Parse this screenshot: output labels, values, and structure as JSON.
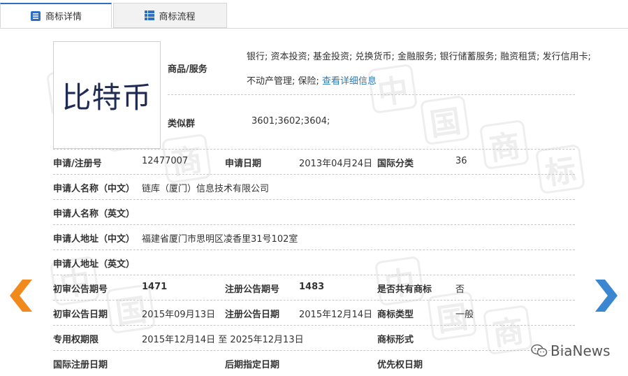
{
  "tabs": [
    {
      "label": "商标详情",
      "icon": "list-icon",
      "active": true
    },
    {
      "label": "商标流程",
      "icon": "grid-icon",
      "active": false
    }
  ],
  "logo_text": "比特币",
  "watermark_chars": [
    "中",
    "国",
    "商",
    "标"
  ],
  "goods": {
    "label": "商品/服务",
    "line1": "银行; 资本投资; 基金投资; 兑换货币; 金融服务; 银行储蓄服务; 融资租赁; 发行信用卡;",
    "line2": "不动产管理; 保险;",
    "link": "查看详细信息"
  },
  "similar": {
    "label": "类似群",
    "value": "3601;3602;3604;"
  },
  "rows": {
    "reg_no": {
      "label": "申请/注册号",
      "value": "12477007"
    },
    "apply_date": {
      "label": "申请日期",
      "value": "2013年04月24日"
    },
    "intl_class": {
      "label": "国际分类",
      "value": "36"
    },
    "applicant_cn": {
      "label": "申请人名称（中文）",
      "value": "链库（厦门）信息技术有限公司"
    },
    "applicant_en": {
      "label": "申请人名称（英文）",
      "value": ""
    },
    "address_cn": {
      "label": "申请人地址（中文）",
      "value": "福建省厦门市思明区凌香里31号102室"
    },
    "address_en": {
      "label": "申请人地址（英文）",
      "value": ""
    },
    "prelim_no": {
      "label": "初审公告期号",
      "value": "1471"
    },
    "reg_pub_no": {
      "label": "注册公告期号",
      "value": "1483"
    },
    "shared": {
      "label": "是否共有商标",
      "value": "否"
    },
    "prelim_date": {
      "label": "初审公告日期",
      "value": "2015年09月13日"
    },
    "reg_pub_date": {
      "label": "注册公告日期",
      "value": "2015年12月14日"
    },
    "mark_type": {
      "label": "商标类型",
      "value": "一般"
    },
    "term": {
      "label": "专用权期限",
      "value": "2015年12月14日 至 2025年12月13日"
    },
    "mark_form": {
      "label": "商标形式",
      "value": ""
    },
    "intl_reg_date": {
      "label": "国际注册日期",
      "value": ""
    },
    "later_date": {
      "label": "后期指定日期",
      "value": ""
    },
    "priority_date": {
      "label": "优先权日期",
      "value": ""
    }
  },
  "nav": {
    "prev": "prev-arrow",
    "next": "next-arrow"
  },
  "brand": "BiaNews",
  "colors": {
    "accent": "#2e6fc1",
    "arrow_prev": "#f08a1c",
    "arrow_next": "#3a86d0",
    "link": "#2a7ab5"
  }
}
